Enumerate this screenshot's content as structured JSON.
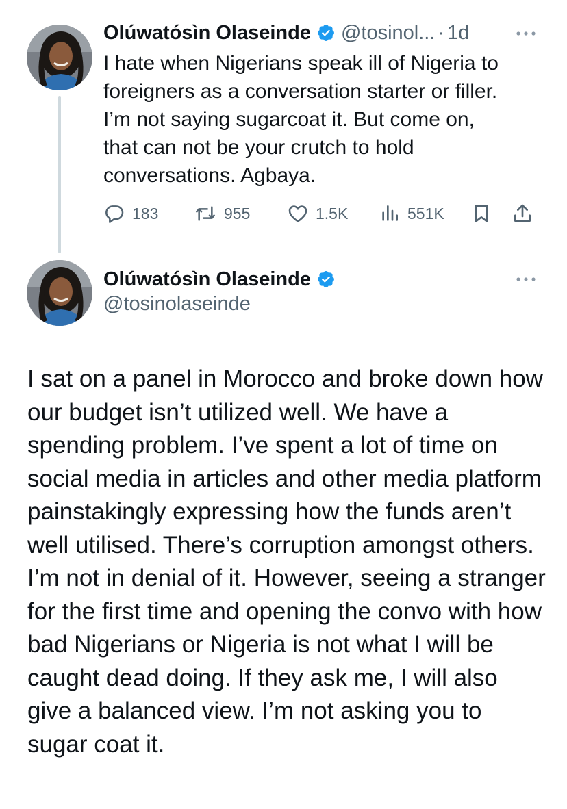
{
  "colors": {
    "text": "#0f1419",
    "secondary": "#536471",
    "verified_blue": "#1d9bf0",
    "thread_line": "#cfd9de"
  },
  "tweet1": {
    "display_name": "Olúwatósìn Olaseinde",
    "handle": "@tosinol...",
    "separator": "·",
    "time": "1d",
    "avatar_icon": "profile-photo",
    "verified_icon": "verified-badge-icon",
    "text": "I hate when Nigerians speak ill of Nigeria to\nforeigners as a conversation starter or filler.\nI’m not saying sugarcoat it. But come on,\nthat can not be your crutch to hold\nconversations. Agbaya.",
    "stats": {
      "replies": "183",
      "reposts": "955",
      "likes": "1.5K",
      "views": "551K"
    }
  },
  "tweet2": {
    "display_name": "Olúwatósìn Olaseinde",
    "handle": "@tosinolaseinde",
    "avatar_icon": "profile-photo",
    "verified_icon": "verified-badge-icon",
    "text": "I sat on a panel in Morocco and broke down how our budget isn’t utilized well. We have a spending problem. I’ve spent a lot of time on social media in articles and other media platform painstakingly expressing how the funds aren’t well utilised. There’s corruption amongst others. I’m not in denial of it. However, seeing a stranger for the first time and opening the convo with how bad Nigerians or Nigeria is not what I will be caught dead doing. If they ask me, I will also give a balanced view. I’m not asking you to sugar coat it."
  }
}
